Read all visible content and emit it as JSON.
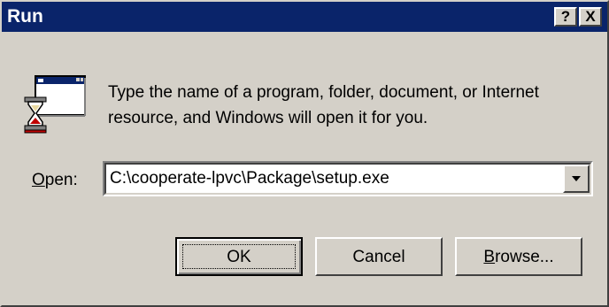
{
  "window": {
    "title": "Run",
    "help_button_label": "?",
    "close_button_label": "X",
    "titlebar_color": "#0a246a",
    "face_color": "#d4d0c8"
  },
  "icon": {
    "name": "run-program-icon"
  },
  "description": {
    "line1": "Type the name of a program, folder, document, or Internet",
    "line2": "resource, and Windows will open it for you."
  },
  "open_field": {
    "label_mnemonic": "O",
    "label_rest": "pen:",
    "value": "C:\\cooperate-lpvc\\Package\\setup.exe"
  },
  "buttons": {
    "ok": "OK",
    "cancel": "Cancel",
    "browse_mnemonic": "B",
    "browse_rest": "rowse..."
  }
}
